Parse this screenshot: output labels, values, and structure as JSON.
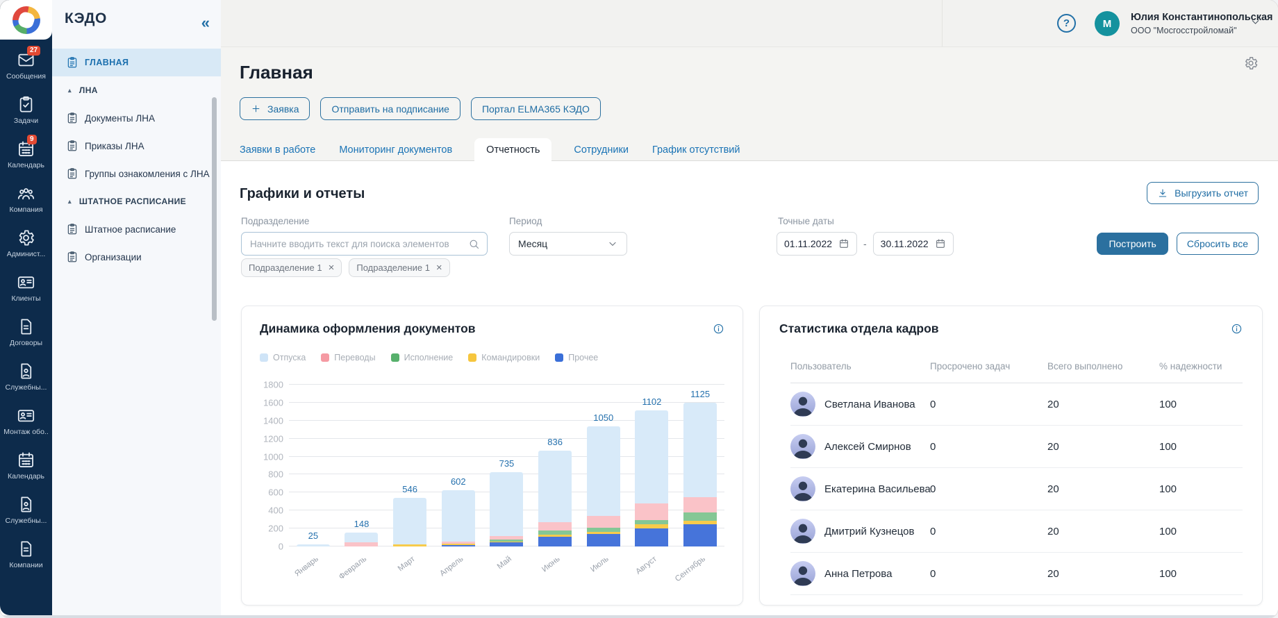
{
  "brand": {
    "app_title": "КЭДО",
    "collapse_glyph": "«"
  },
  "rail": {
    "items": [
      {
        "label": "Сообщения",
        "icon": "envelope",
        "badge": "27"
      },
      {
        "label": "Задачи",
        "icon": "clipboard-check"
      },
      {
        "label": "Календарь",
        "icon": "calendar",
        "badge": "9"
      },
      {
        "label": "Компания",
        "icon": "people"
      },
      {
        "label": "Админист...",
        "icon": "gear"
      },
      {
        "label": "Клиенты",
        "icon": "id-card"
      },
      {
        "label": "Договоры",
        "icon": "document"
      },
      {
        "label": "Служебны...",
        "icon": "document-person"
      },
      {
        "label": "Монтаж обо..",
        "icon": "id-card"
      },
      {
        "label": "Календарь",
        "icon": "calendar"
      },
      {
        "label": "Служебны...",
        "icon": "document-person"
      },
      {
        "label": "Компании",
        "icon": "document"
      }
    ]
  },
  "menu": {
    "group_arrow": "▴",
    "items": [
      {
        "type": "item",
        "label": "ГЛАВНАЯ",
        "active": true
      },
      {
        "type": "group",
        "label": "ЛНА"
      },
      {
        "type": "item",
        "label": "Документы ЛНА"
      },
      {
        "type": "item",
        "label": "Приказы ЛНА"
      },
      {
        "type": "item",
        "label": "Группы ознакомления с ЛНА"
      },
      {
        "type": "group",
        "label": "ШТАТНОЕ РАСПИСАНИЕ"
      },
      {
        "type": "item",
        "label": "Штатное расписание"
      },
      {
        "type": "item",
        "label": "Организации"
      }
    ]
  },
  "header": {
    "help_glyph": "?",
    "avatar_initial": "M",
    "user_name": "Юлия Константинопольская",
    "user_company": "ООО \"Мосгосстройломай\""
  },
  "page": {
    "title": "Главная",
    "actions": [
      {
        "label": "Заявка",
        "icon": "plus"
      },
      {
        "label": "Отправить на подписание"
      },
      {
        "label": "Портал ELMA365 КЭДО"
      }
    ],
    "tabs": [
      "Заявки в работе",
      "Мониторинг документов",
      "Отчетность",
      "Сотрудники",
      "График отсутствий"
    ],
    "active_tab_index": 2
  },
  "toolbar": {
    "section_title": "Графики и отчеты",
    "export_label": "Выгрузить отчет"
  },
  "filters": {
    "department": {
      "label": "Подразделение",
      "placeholder": "Начните вводить текст для поиска элементов",
      "chips": [
        "Подразделение 1",
        "Подразделение 1"
      ],
      "chip_close_glyph": "×"
    },
    "period": {
      "label": "Период",
      "value": "Месяц"
    },
    "dates": {
      "label": "Точные даты",
      "from": "01.11.2022",
      "separator": "-",
      "to": "30.11.2022"
    },
    "build_label": "Построить",
    "reset_label": "Сбросить все"
  },
  "chart_data": {
    "type": "bar",
    "stacked": true,
    "title": "Динамика оформления документов",
    "categories": [
      "Январь",
      "Февраль",
      "Март",
      "Апрель",
      "Май",
      "Июнь",
      "Июль",
      "Август",
      "Сентябрь"
    ],
    "bar_total_labels": [
      "25",
      "148",
      "546",
      "602",
      "735",
      "836",
      "1050",
      "1102",
      "1125"
    ],
    "series": [
      {
        "name": "Прочее",
        "color": "#4674da",
        "values": [
          0,
          0,
          0,
          12,
          45,
          110,
          140,
          205,
          245
        ]
      },
      {
        "name": "Командировки",
        "color": "#f7cb4b",
        "values": [
          0,
          0,
          20,
          18,
          12,
          22,
          22,
          45,
          40
        ]
      },
      {
        "name": "Исполнение",
        "color": "#85c795",
        "values": [
          0,
          0,
          0,
          0,
          18,
          48,
          48,
          48,
          90
        ]
      },
      {
        "name": "Переводы",
        "color": "#fac3c8",
        "values": [
          0,
          45,
          0,
          25,
          45,
          95,
          130,
          180,
          175
        ]
      },
      {
        "name": "Отпуска",
        "color": "#d8eaf9",
        "values": [
          25,
          110,
          520,
          575,
          710,
          790,
          1000,
          1040,
          1050
        ]
      }
    ],
    "legend": [
      {
        "label": "Отпуска",
        "color": "#cfe4f7"
      },
      {
        "label": "Переводы",
        "color": "#f59aa3"
      },
      {
        "label": "Исполнение",
        "color": "#57b06c"
      },
      {
        "label": "Командировки",
        "color": "#f6c63e"
      },
      {
        "label": "Прочее",
        "color": "#3a6fd8"
      }
    ],
    "y_ticks": [
      0,
      200,
      400,
      600,
      800,
      1000,
      1200,
      1400,
      1600,
      1800
    ],
    "ylim": [
      0,
      1800
    ],
    "grid": true,
    "legend_position": "top"
  },
  "stats_card": {
    "title": "Статистика отдела кадров",
    "columns": [
      "Пользователь",
      "Просрочено задач",
      "Всего выполнено",
      "% надежности"
    ],
    "rows": [
      {
        "name": "Светлана Иванова",
        "overdue": "0",
        "completed": "20",
        "reliability": "100"
      },
      {
        "name": "Алексей Смирнов",
        "overdue": "0",
        "completed": "20",
        "reliability": "100"
      },
      {
        "name": "Екатерина Васильева",
        "overdue": "0",
        "completed": "20",
        "reliability": "100"
      },
      {
        "name": "Дмитрий Кузнецов",
        "overdue": "0",
        "completed": "20",
        "reliability": "100"
      },
      {
        "name": "Анна Петрова",
        "overdue": "0",
        "completed": "20",
        "reliability": "100"
      }
    ]
  }
}
